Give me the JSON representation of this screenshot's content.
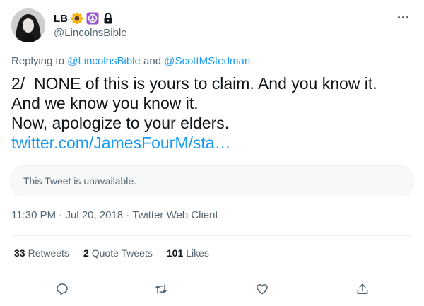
{
  "author": {
    "display_name": "LB",
    "handle": "@LincolnsBible",
    "name_emojis": [
      "sunflower-icon",
      "peace-sign-icon",
      "lock-icon"
    ]
  },
  "reply_context": {
    "prefix": "Replying to ",
    "mention_1": "@LincolnsBible",
    "joiner": " and ",
    "mention_2": "@ScottMStedman"
  },
  "tweet": {
    "lines": [
      "2/  NONE of this is yours to claim. And you know it.",
      "And we know you know it.",
      "Now, apologize to your elders."
    ],
    "link": "twitter.com/JamesFourM/sta…"
  },
  "quoted_card": {
    "text": "This Tweet is unavailable."
  },
  "meta": {
    "time": "11:30 PM",
    "date": "Jul 20, 2018",
    "client": "Twitter Web Client",
    "separator": " · "
  },
  "stats": {
    "retweets_count": "33",
    "retweets_label": "Retweets",
    "quotes_count": "2",
    "quotes_label": "Quote Tweets",
    "likes_count": "101",
    "likes_label": "Likes"
  },
  "actions": [
    "reply-icon",
    "retweet-icon",
    "like-icon",
    "share-icon"
  ],
  "colors": {
    "link": "#1d9bf0",
    "secondary_text": "#536471",
    "primary_text": "#0f1419",
    "divider": "#eff3f4",
    "card_bg": "#f7f9f9"
  }
}
